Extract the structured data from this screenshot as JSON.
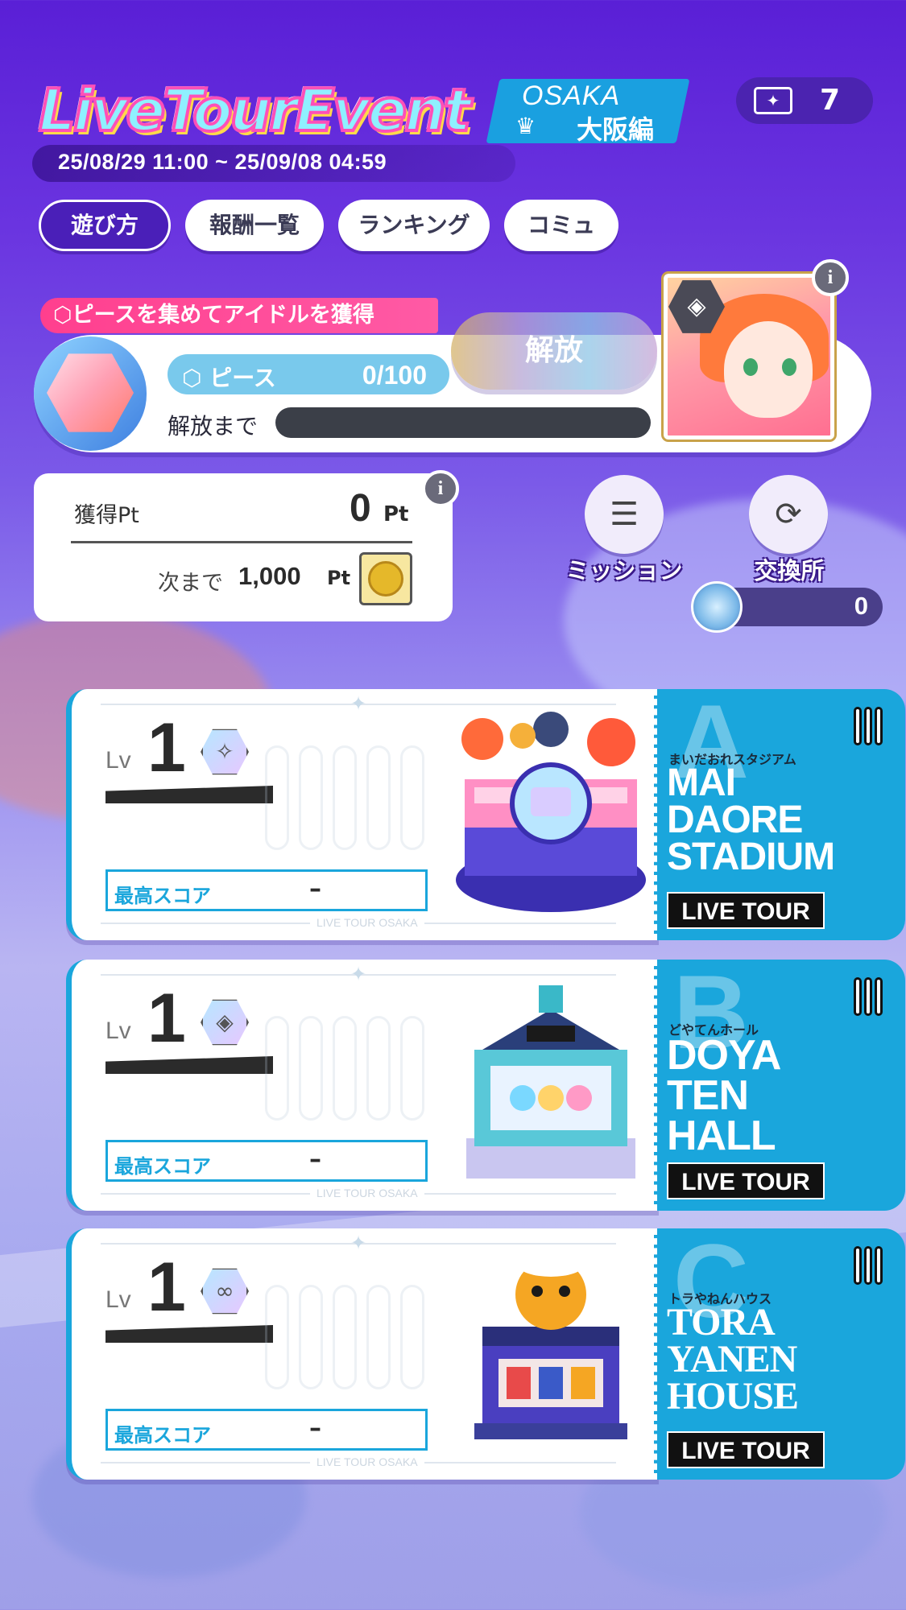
{
  "header": {
    "logo_text": "LiveTourEvent",
    "location_en": "OSAKA",
    "location_jp": "大阪編",
    "period": "25/08/29 11:00 ~ 25/09/08 04:59"
  },
  "ticket": {
    "icon": "ticket-icon",
    "count": "7"
  },
  "tabs": [
    {
      "label": "遊び方",
      "active": true
    },
    {
      "label": "報酬一覧",
      "active": false
    },
    {
      "label": "ランキング",
      "active": false
    },
    {
      "label": "コミュ",
      "active": false
    }
  ],
  "piece": {
    "banner": "⬡ピースを集めてアイドルを獲得",
    "label": "⬡ ピース",
    "value": "0/100",
    "unlock_until": "解放まで",
    "progress": 0,
    "unlock_button": "解放"
  },
  "points": {
    "label": "獲得Pt",
    "value": "0",
    "unit": "Pt",
    "next_label": "次まで",
    "next_value": "1,000",
    "next_unit": "Pt"
  },
  "actions": {
    "mission": "ミッション",
    "exchange": "交換所",
    "medal_count": "0"
  },
  "venues": [
    {
      "letter": "A",
      "kana": "まいだおれスタジアム",
      "name": "MAI\nDAORE\nSTADIUM",
      "live_tour": "LIVE TOUR",
      "lv_label": "Lv",
      "level": "1",
      "score_label": "最高スコア",
      "score_value": "–",
      "footer": "LIVE TOUR OSAKA",
      "colors": {
        "stage": "#ff5aa5",
        "accent": "#4a4ae0"
      }
    },
    {
      "letter": "B",
      "kana": "どやてんホール",
      "name": "DOYA\nTEN\nHALL",
      "live_tour": "LIVE TOUR",
      "lv_label": "Lv",
      "level": "1",
      "score_label": "最高スコア",
      "score_value": "–",
      "footer": "LIVE TOUR OSAKA",
      "colors": {
        "stage": "#4ad0c8",
        "accent": "#6a5ae0"
      }
    },
    {
      "letter": "C",
      "kana": "トラやねんハウス",
      "name": "TORA\nYANEN\nHOUSE",
      "live_tour": "LIVE TOUR",
      "lv_label": "Lv",
      "level": "1",
      "score_label": "最高スコア",
      "score_value": "–",
      "footer": "LIVE TOUR OSAKA",
      "colors": {
        "stage": "#f5a623",
        "accent": "#5a3fc0"
      }
    }
  ]
}
